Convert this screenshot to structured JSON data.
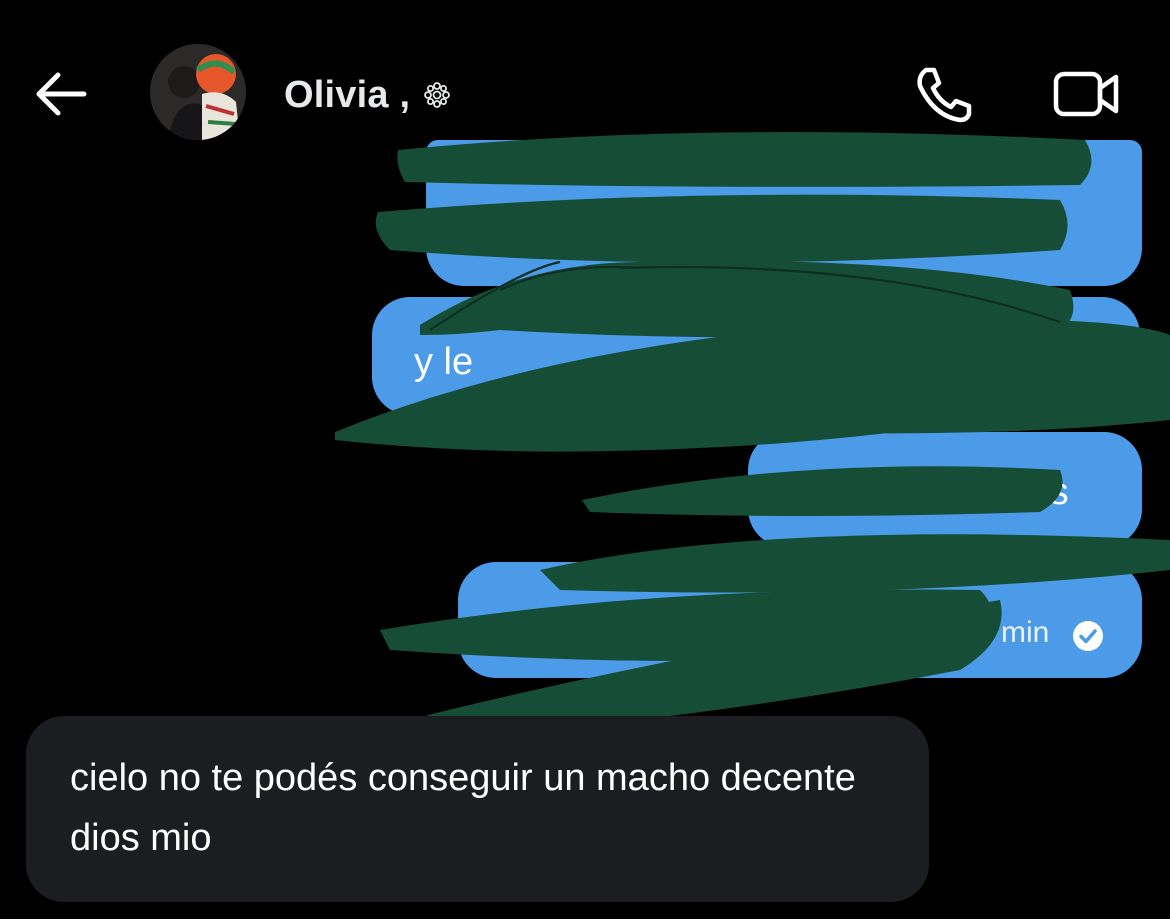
{
  "header": {
    "contact_name": "Olivia ,",
    "badge_symbol": "❋",
    "back_icon": "arrow-left-icon",
    "call_icon": "phone-icon",
    "video_icon": "video-camera-icon"
  },
  "messages": [
    {
      "direction": "sent",
      "text": "",
      "redacted": true
    },
    {
      "direction": "sent",
      "text": "y le",
      "redacted": true
    },
    {
      "direction": "sent",
      "text": "los",
      "redacted": true
    },
    {
      "direction": "sent",
      "text": "",
      "time": "1 min",
      "status_icon": "read-check-icon",
      "redacted": true
    },
    {
      "direction": "received",
      "text": "cielo no te podés conseguir un macho decente dios mio"
    }
  ],
  "colors": {
    "background": "#000000",
    "sent_bubble": "#4c9be8",
    "received_bubble": "#1b1d20",
    "redaction": "#164d36"
  }
}
